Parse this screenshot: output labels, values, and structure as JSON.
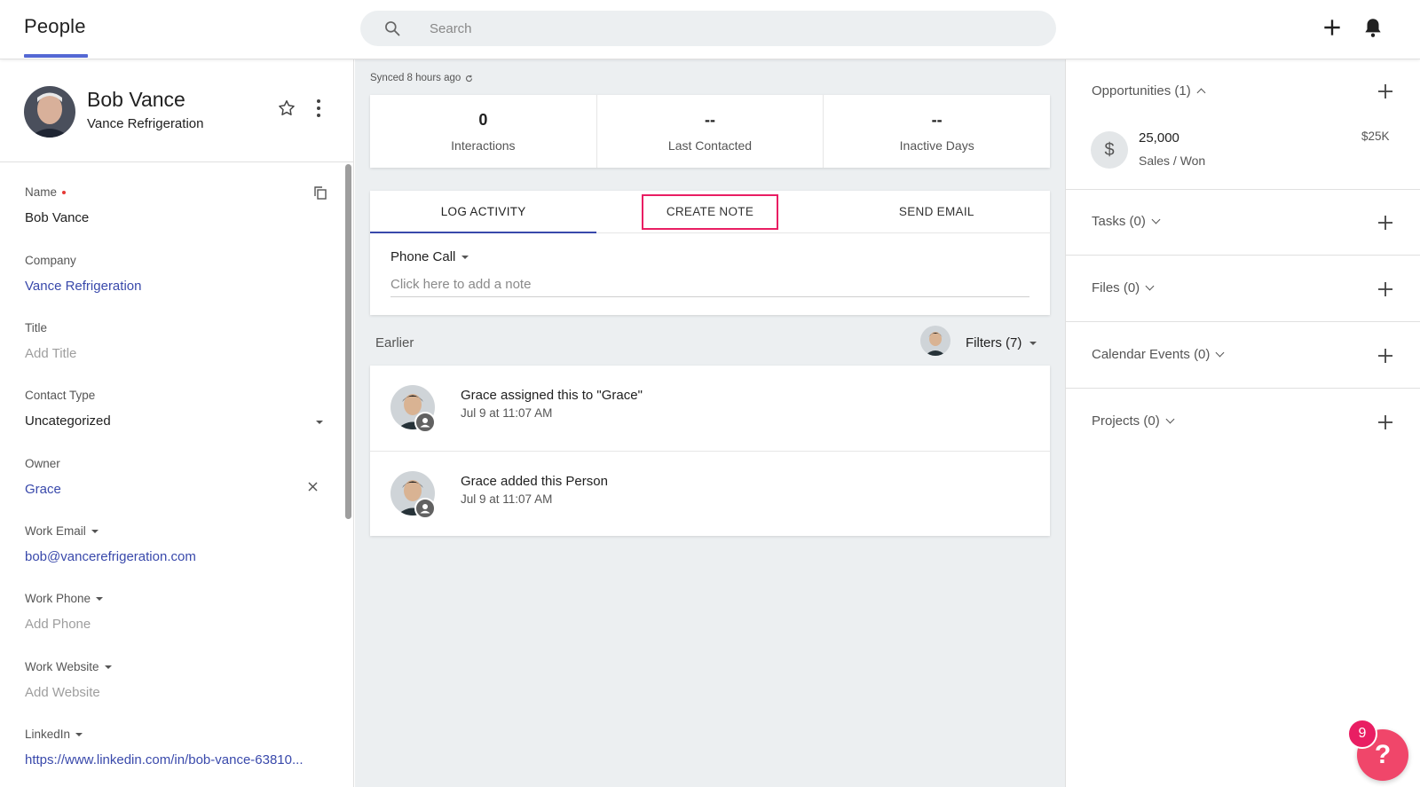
{
  "header": {
    "title": "People",
    "search_placeholder": "Search"
  },
  "contact": {
    "name": "Bob Vance",
    "company": "Vance Refrigeration"
  },
  "fields": {
    "name_label": "Name",
    "name_value": "Bob Vance",
    "company_label": "Company",
    "company_value": "Vance Refrigeration",
    "title_label": "Title",
    "title_placeholder": "Add Title",
    "contact_type_label": "Contact Type",
    "contact_type_value": "Uncategorized",
    "owner_label": "Owner",
    "owner_value": "Grace",
    "work_email_label": "Work Email",
    "work_email_value": "bob@vancerefrigeration.com",
    "work_phone_label": "Work Phone",
    "work_phone_placeholder": "Add Phone",
    "work_website_label": "Work Website",
    "work_website_placeholder": "Add Website",
    "linkedin_label": "LinkedIn",
    "linkedin_value": "https://www.linkedin.com/in/bob-vance-63810..."
  },
  "sync": {
    "text": "Synced 8 hours ago"
  },
  "stats": [
    {
      "value": "0",
      "label": "Interactions"
    },
    {
      "value": "--",
      "label": "Last Contacted"
    },
    {
      "value": "--",
      "label": "Inactive Days"
    }
  ],
  "activity": {
    "tabs": [
      "LOG ACTIVITY",
      "CREATE NOTE",
      "SEND EMAIL"
    ],
    "active_tab": "LOG ACTIVITY",
    "highlighted_tab": "CREATE NOTE",
    "log_type": "Phone Call",
    "note_placeholder": "Click here to add a note"
  },
  "feed": {
    "section_label": "Earlier",
    "filters_label": "Filters (7)",
    "items": [
      {
        "title": "Grace assigned this to \"Grace\"",
        "time": "Jul 9 at 11:07 AM"
      },
      {
        "title": "Grace added this Person",
        "time": "Jul 9 at 11:07 AM"
      }
    ]
  },
  "sidebar": {
    "opportunities_label": "Opportunities (1)",
    "opportunity": {
      "amount": "25,000",
      "stage": "Sales / Won",
      "value": "$25K",
      "icon": "dollar-icon"
    },
    "tasks_label": "Tasks (0)",
    "files_label": "Files (0)",
    "calendar_label": "Calendar Events (0)",
    "projects_label": "Projects (0)"
  },
  "help": {
    "icon": "?",
    "badge_count": "9"
  },
  "colors": {
    "accent": "#3949ab",
    "title_underline": "#5468d4",
    "highlight": "#e91e63",
    "help": "#f0466a",
    "background": "#eceff1"
  }
}
